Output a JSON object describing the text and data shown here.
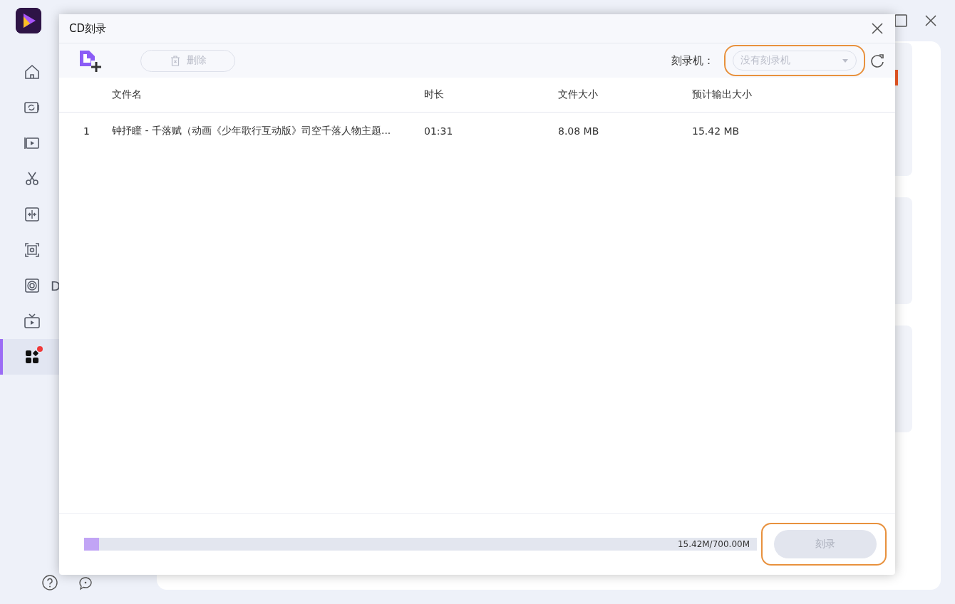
{
  "app": {
    "sidebar": [
      {
        "selected": false,
        "badge": false
      },
      {
        "selected": false,
        "badge": false
      },
      {
        "selected": false,
        "badge": false
      },
      {
        "selected": false,
        "badge": false
      },
      {
        "selected": false,
        "badge": false
      },
      {
        "selected": false,
        "badge": false
      },
      {
        "label": "D",
        "selected": false,
        "badge": false
      },
      {
        "selected": false,
        "badge": false
      },
      {
        "selected": true,
        "badge": true
      }
    ]
  },
  "dialog": {
    "title": "CD刻录",
    "toolbar": {
      "delete_label": "删除",
      "delete_disabled": true,
      "burner_label": "刻录机：",
      "burner_placeholder": "没有刻录机"
    },
    "columns": [
      "文件名",
      "时长",
      "文件大小",
      "预计输出大小"
    ],
    "rows": [
      {
        "index": "1",
        "name": "钟抒瞳 - 千落赋（动画《少年歌行互动版》司空千落人物主题...",
        "duration": "01:31",
        "size": "8.08 MB",
        "output_size": "15.42 MB"
      }
    ],
    "capacity": {
      "level": 0.022,
      "reading": "15.42M/700.00M"
    },
    "burn_label": "刻录",
    "burn_disabled": true
  }
}
